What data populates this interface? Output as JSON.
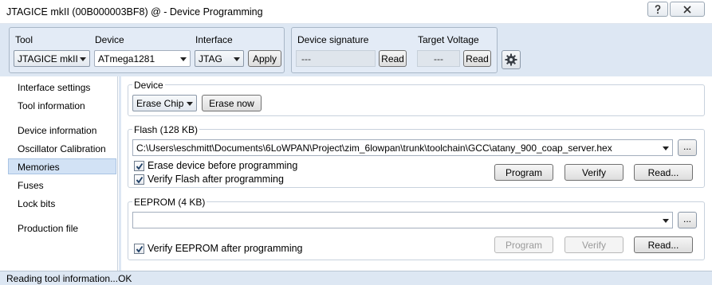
{
  "window": {
    "title": "JTAGICE mkII (00B000003BF8) @  - Device Programming"
  },
  "toolbar": {
    "tool_label": "Tool",
    "tool_value": "JTAGICE mkII",
    "device_label": "Device",
    "device_value": "ATmega1281",
    "interface_label": "Interface",
    "interface_value": "JTAG",
    "apply_label": "Apply",
    "signature_label": "Device signature",
    "signature_value": "---",
    "signature_read": "Read",
    "voltage_label": "Target Voltage",
    "voltage_value": "---",
    "voltage_read": "Read"
  },
  "sidebar": {
    "items": [
      {
        "label": "Interface settings"
      },
      {
        "label": "Tool information"
      },
      {
        "label": "Device information"
      },
      {
        "label": "Oscillator Calibration"
      },
      {
        "label": "Memories"
      },
      {
        "label": "Fuses"
      },
      {
        "label": "Lock bits"
      },
      {
        "label": "Production file"
      }
    ],
    "active": "Memories"
  },
  "device_section": {
    "title": "Device",
    "erase_combo": "Erase Chip",
    "erase_now": "Erase now"
  },
  "flash_section": {
    "title": "Flash (128 KB)",
    "path": "C:\\Users\\eschmitt\\Documents\\6LoWPAN\\Project\\zim_6lowpan\\trunk\\toolchain\\GCC\\atany_900_coap_server.hex",
    "browse": "...",
    "erase_before": "Erase device before programming",
    "erase_before_checked": true,
    "verify_after": "Verify Flash after programming",
    "verify_after_checked": true,
    "program": "Program",
    "verify": "Verify",
    "read": "Read..."
  },
  "eeprom_section": {
    "title": "EEPROM (4 KB)",
    "path": "",
    "browse": "...",
    "verify_after": "Verify EEPROM after programming",
    "verify_after_checked": true,
    "program": "Program",
    "verify": "Verify",
    "read": "Read..."
  },
  "status": {
    "text": "Reading tool information...OK"
  }
}
